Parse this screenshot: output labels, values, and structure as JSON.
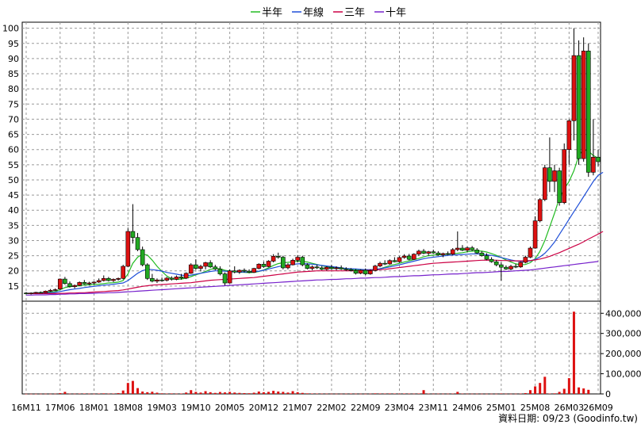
{
  "chart_data": {
    "type": "candlestick+volume",
    "title": "",
    "legend": [
      {
        "name": "半年",
        "color": "#22bb22"
      },
      {
        "name": "年線",
        "color": "#1f4fd8"
      },
      {
        "name": "三年",
        "color": "#cc0044"
      },
      {
        "name": "十年",
        "color": "#7722cc"
      }
    ],
    "legend_position": "top-center",
    "grid": true,
    "colors": {
      "up": "#dd1111",
      "down": "#22aa22",
      "volume": "#dd1111"
    },
    "price_axis": {
      "min": 10,
      "max": 102,
      "ticks": [
        15,
        20,
        25,
        30,
        35,
        40,
        45,
        50,
        55,
        60,
        65,
        70,
        75,
        80,
        85,
        90,
        95,
        100
      ]
    },
    "volume_axis": {
      "max": 460000,
      "ticks": [
        0,
        100000,
        200000,
        300000,
        400000
      ],
      "tick_labels": [
        "0",
        "100,000",
        "200,000",
        "300,000",
        "400,000"
      ]
    },
    "x_ticks": [
      {
        "label": "16M11",
        "i": 0
      },
      {
        "label": "17M06",
        "i": 7
      },
      {
        "label": "18M01",
        "i": 14
      },
      {
        "label": "18M08",
        "i": 21
      },
      {
        "label": "19M03",
        "i": 28
      },
      {
        "label": "19M10",
        "i": 35
      },
      {
        "label": "20M05",
        "i": 42
      },
      {
        "label": "20M12",
        "i": 49
      },
      {
        "label": "21M07",
        "i": 56
      },
      {
        "label": "22M02",
        "i": 63
      },
      {
        "label": "22M09",
        "i": 70
      },
      {
        "label": "23M04",
        "i": 77
      },
      {
        "label": "23M11",
        "i": 84
      },
      {
        "label": "24M06",
        "i": 91
      },
      {
        "label": "25M01",
        "i": 98
      },
      {
        "label": "25M08",
        "i": 105
      },
      {
        "label": "26M03",
        "i": 112
      },
      {
        "label": "26M09",
        "i": 118
      }
    ],
    "ohlc": [
      [
        12.7,
        13,
        12.3,
        12.5
      ],
      [
        12.5,
        12.9,
        12.2,
        12.7
      ],
      [
        12.7,
        13.1,
        12.5,
        12.9
      ],
      [
        12.9,
        13.2,
        12.6,
        12.8
      ],
      [
        12.8,
        13.5,
        12.7,
        13.3
      ],
      [
        13.3,
        14,
        13.1,
        13.6
      ],
      [
        13.6,
        14.2,
        13.4,
        13.8
      ],
      [
        14,
        17.5,
        13.8,
        17.3
      ],
      [
        17.3,
        18,
        15.5,
        15.8
      ],
      [
        15.8,
        16.5,
        14.5,
        14.8
      ],
      [
        14.8,
        15.5,
        14.2,
        15.2
      ],
      [
        15.2,
        16.5,
        15,
        16.2
      ],
      [
        16.2,
        17,
        15.5,
        15.7
      ],
      [
        15.7,
        16.4,
        15.3,
        16
      ],
      [
        16,
        16.5,
        15.5,
        16.3
      ],
      [
        16.3,
        17.5,
        16,
        16.8
      ],
      [
        16.8,
        18.5,
        16.5,
        17.5
      ],
      [
        17.5,
        18,
        16.5,
        16.8
      ],
      [
        16.8,
        17.5,
        16.3,
        17.2
      ],
      [
        17.2,
        17.8,
        16.8,
        17.5
      ],
      [
        17.5,
        22,
        17.2,
        21.5
      ],
      [
        21.5,
        34,
        21.2,
        33
      ],
      [
        33,
        42,
        29,
        31
      ],
      [
        31,
        32.5,
        26.5,
        27
      ],
      [
        27,
        28,
        21.5,
        22
      ],
      [
        22,
        22.5,
        17,
        17.5
      ],
      [
        17.5,
        19,
        16.2,
        16.6
      ],
      [
        16.6,
        17.5,
        16,
        17
      ],
      [
        17,
        17.8,
        16.4,
        16.9
      ],
      [
        16.9,
        18,
        16.5,
        17.6
      ],
      [
        17.6,
        18.2,
        16.8,
        17.2
      ],
      [
        17.2,
        18.5,
        16.9,
        18
      ],
      [
        18,
        19,
        17.1,
        17.6
      ],
      [
        17.6,
        19.5,
        17.3,
        19.2
      ],
      [
        19.2,
        22.5,
        19,
        22
      ],
      [
        22,
        23.8,
        20.4,
        20.8
      ],
      [
        20.8,
        22,
        19.8,
        21.5
      ],
      [
        21.5,
        23,
        20.5,
        22.7
      ],
      [
        22.7,
        23.5,
        21,
        21.3
      ],
      [
        21.3,
        22,
        20.2,
        20.6
      ],
      [
        20.6,
        21.5,
        18.5,
        19
      ],
      [
        19,
        19.5,
        15.2,
        16
      ],
      [
        16,
        20.5,
        15.8,
        20
      ],
      [
        20,
        21.5,
        19.2,
        19.6
      ],
      [
        19.6,
        20.5,
        19,
        20.2
      ],
      [
        20.2,
        20.8,
        19.5,
        19.9
      ],
      [
        19.9,
        20.5,
        19.2,
        19.5
      ],
      [
        19.5,
        21,
        19.3,
        20.8
      ],
      [
        20.8,
        22.5,
        20.5,
        22.2
      ],
      [
        22.2,
        23,
        21,
        21.4
      ],
      [
        21.4,
        23.5,
        21.2,
        23.2
      ],
      [
        23.2,
        25.5,
        22.8,
        24.8
      ],
      [
        24.8,
        26,
        24,
        24.5
      ],
      [
        24.5,
        25,
        20.5,
        21
      ],
      [
        21,
        22.5,
        20.5,
        22
      ],
      [
        22,
        24,
        21.8,
        23.5
      ],
      [
        23.5,
        25.2,
        22.8,
        24.5
      ],
      [
        24.5,
        25,
        21.5,
        22
      ],
      [
        22,
        22.5,
        20.5,
        20.8
      ],
      [
        20.8,
        21.8,
        20.2,
        21.3
      ],
      [
        21.3,
        22,
        20.6,
        21
      ],
      [
        21,
        21.6,
        20.2,
        20.5
      ],
      [
        20.5,
        21.5,
        20.1,
        21.2
      ],
      [
        21.2,
        22,
        20.4,
        20.7
      ],
      [
        20.7,
        21.5,
        20.2,
        21
      ],
      [
        21,
        21.8,
        20.3,
        20.6
      ],
      [
        20.6,
        21.2,
        20,
        20.4
      ],
      [
        20.4,
        20.9,
        19.8,
        20.1
      ],
      [
        20.1,
        20.6,
        18.8,
        19.2
      ],
      [
        19.2,
        20.5,
        18.9,
        20.2
      ],
      [
        20.2,
        20.8,
        18.6,
        19
      ],
      [
        19,
        20.5,
        18.7,
        20.1
      ],
      [
        20.1,
        22,
        19.8,
        21.6
      ],
      [
        21.6,
        23,
        21.2,
        22.5
      ],
      [
        22.5,
        23.5,
        21.9,
        22.3
      ],
      [
        22.3,
        23.8,
        22,
        23.4
      ],
      [
        23.4,
        24.5,
        22.8,
        23
      ],
      [
        23,
        24.8,
        22.7,
        24.4
      ],
      [
        24.4,
        25.5,
        24,
        24.9
      ],
      [
        24.9,
        25.6,
        23.5,
        23.8
      ],
      [
        23.8,
        25.8,
        23.6,
        25.5
      ],
      [
        25.5,
        27,
        25,
        26.5
      ],
      [
        26.5,
        27.2,
        25.5,
        25.8
      ],
      [
        25.8,
        26.6,
        25,
        26.3
      ],
      [
        26.3,
        27,
        25.6,
        25.9
      ],
      [
        25.9,
        26.5,
        25,
        25.3
      ],
      [
        25.3,
        26,
        24.5,
        25.7
      ],
      [
        25.7,
        26.4,
        25.2,
        25.5
      ],
      [
        25.5,
        27.5,
        25.2,
        27
      ],
      [
        27,
        33,
        26.5,
        27.5
      ],
      [
        27.5,
        28.5,
        26.5,
        26.8
      ],
      [
        26.8,
        28,
        26.2,
        27.6
      ],
      [
        27.6,
        28.2,
        26.6,
        26.9
      ],
      [
        26.9,
        27.5,
        25.6,
        25.9
      ],
      [
        25.9,
        26.5,
        24.7,
        25
      ],
      [
        25,
        25.8,
        23.5,
        23.8
      ],
      [
        23.8,
        24.5,
        22.7,
        23
      ],
      [
        23,
        23.6,
        21.5,
        22
      ],
      [
        22,
        22.8,
        16.8,
        21.2
      ],
      [
        21.2,
        21.8,
        20.3,
        20.6
      ],
      [
        20.6,
        22,
        20.2,
        21.5
      ],
      [
        21.5,
        22.3,
        20.9,
        21.3
      ],
      [
        21.3,
        23,
        21,
        22.8
      ],
      [
        22.8,
        25,
        22.5,
        24.5
      ],
      [
        24.5,
        28,
        24.2,
        27.5
      ],
      [
        27.5,
        38,
        27.3,
        36.5
      ],
      [
        36.5,
        44,
        36,
        43.5
      ],
      [
        43.5,
        55,
        43,
        54
      ],
      [
        54,
        64,
        46,
        49.5
      ],
      [
        49.5,
        55,
        46,
        53
      ],
      [
        53,
        54,
        41.5,
        42.5
      ],
      [
        42.5,
        62,
        42,
        60
      ],
      [
        60,
        70,
        55,
        69.5
      ],
      [
        69.5,
        100,
        63,
        91
      ],
      [
        91,
        96,
        55,
        57
      ],
      [
        57,
        97,
        56,
        92.5
      ],
      [
        92.5,
        95,
        51,
        52.5
      ],
      [
        52.5,
        70,
        51.5,
        57.5
      ],
      [
        57.5,
        60,
        54.5,
        56
      ]
    ],
    "volume": [
      1500,
      2000,
      1800,
      2500,
      3000,
      2200,
      3500,
      12000,
      30000,
      4000,
      3500,
      5000,
      6000,
      4000,
      3000,
      5500,
      8000,
      4500,
      6000,
      12000,
      50000,
      160000,
      190000,
      85000,
      35000,
      25000,
      32000,
      18000,
      8000,
      5000,
      7000,
      4000,
      6000,
      20000,
      55000,
      30000,
      20000,
      40000,
      25000,
      15000,
      28000,
      22000,
      30000,
      20000,
      15000,
      12000,
      10000,
      18000,
      35000,
      25000,
      30000,
      45000,
      35000,
      30000,
      20000,
      40000,
      25000,
      15000,
      8000,
      6000,
      5000,
      4500,
      4000,
      3500,
      3000,
      2800,
      4000,
      5000,
      3500,
      3000,
      2500,
      4000,
      8000,
      6500,
      5000,
      7000,
      5500,
      4500,
      6000,
      5000,
      4000,
      6000,
      55000,
      5000,
      3500,
      4000,
      3000,
      3500,
      5000,
      30000,
      4500,
      3500,
      3000,
      3500,
      3000,
      2500,
      3000,
      2500,
      6000,
      3000,
      2500,
      3000,
      5000,
      12000,
      55000,
      110000,
      160000,
      250000,
      6000,
      8000,
      30000,
      75000,
      230000,
      1200000,
      95000,
      80000,
      60000
    ],
    "vol_scale": 0.34,
    "ma": {
      "半年": [
        12.6,
        12.6,
        12.7,
        12.8,
        12.9,
        13,
        13.2,
        13.8,
        14.5,
        14.8,
        14.9,
        15.1,
        15.3,
        15.4,
        15.5,
        15.6,
        15.8,
        16,
        16.1,
        16.3,
        16.8,
        19,
        22.5,
        24.5,
        25.5,
        25.2,
        23.5,
        21.5,
        19.8,
        18.3,
        17.4,
        17.2,
        17.3,
        17.6,
        18.1,
        18.7,
        19.2,
        19.8,
        20.5,
        20.8,
        20.7,
        20.2,
        19.9,
        19.7,
        19.6,
        19.5,
        19.4,
        19.5,
        19.8,
        20.3,
        21,
        21.8,
        22.4,
        22.7,
        22.8,
        23,
        23.2,
        23.1,
        22.9,
        22.5,
        22.1,
        21.7,
        21.4,
        21.1,
        20.9,
        20.8,
        20.6,
        20.5,
        20.3,
        20.2,
        20.1,
        20.1,
        20.3,
        20.7,
        21.2,
        21.7,
        22.1,
        22.5,
        22.9,
        23.3,
        23.7,
        24.1,
        24.6,
        25,
        25.2,
        25.3,
        25.4,
        25.5,
        25.6,
        25.8,
        26,
        26.3,
        26.5,
        26.6,
        26.5,
        26.2,
        25.7,
        25.1,
        24.4,
        23.6,
        22.9,
        22.3,
        22,
        22.1,
        22.7,
        24,
        26.5,
        30,
        34.5,
        39,
        44,
        47,
        49.5,
        53,
        58,
        60,
        59.5,
        58,
        57.2
      ],
      "年線": [
        12.6,
        12.6,
        12.6,
        12.7,
        12.7,
        12.8,
        12.9,
        13.2,
        13.5,
        13.8,
        14,
        14.2,
        14.5,
        14.7,
        14.9,
        15.1,
        15.3,
        15.4,
        15.6,
        15.8,
        16,
        16.8,
        18,
        19.2,
        20.1,
        20.5,
        20.4,
        20.2,
        19.9,
        19.5,
        19.2,
        18.9,
        18.6,
        18.4,
        18.6,
        18.9,
        19.2,
        19.5,
        19.8,
        20,
        20,
        19.9,
        19.8,
        19.7,
        19.6,
        19.6,
        19.6,
        19.7,
        19.9,
        20.2,
        20.6,
        21,
        21.4,
        21.7,
        21.9,
        22.1,
        22.3,
        22.4,
        22.3,
        22.2,
        22,
        21.8,
        21.6,
        21.4,
        21.2,
        21,
        20.8,
        20.7,
        20.6,
        20.5,
        20.4,
        20.4,
        20.5,
        20.7,
        21,
        21.3,
        21.6,
        22,
        22.4,
        22.8,
        23.2,
        23.6,
        24,
        24.3,
        24.5,
        24.7,
        24.9,
        25.1,
        25.2,
        25.3,
        25.4,
        25.5,
        25.6,
        25.6,
        25.5,
        25.3,
        25.1,
        24.8,
        24.4,
        24,
        23.6,
        23.3,
        23.1,
        23.1,
        23.3,
        23.8,
        24.6,
        25.8,
        27.5,
        29.5,
        32,
        34.5,
        37,
        39.5,
        42,
        44.5,
        47,
        49.5,
        51.5,
        52.5
      ],
      "三年": [
        12.5,
        12.5,
        12.5,
        12.5,
        12.5,
        12.5,
        12.5,
        12.6,
        12.6,
        12.7,
        12.7,
        12.8,
        12.8,
        12.9,
        13,
        13.1,
        13.2,
        13.3,
        13.4,
        13.5,
        13.7,
        14,
        14.3,
        14.6,
        14.9,
        15.1,
        15.3,
        15.4,
        15.5,
        15.6,
        15.7,
        15.8,
        15.9,
        16,
        16.1,
        16.3,
        16.5,
        16.7,
        16.9,
        17,
        17.1,
        17.2,
        17.3,
        17.4,
        17.5,
        17.6,
        17.7,
        17.8,
        18,
        18.2,
        18.4,
        18.6,
        18.8,
        19,
        19.2,
        19.4,
        19.6,
        19.7,
        19.8,
        19.9,
        20,
        20,
        20,
        20,
        20,
        20,
        20,
        20,
        20,
        20.1,
        20.1,
        20.2,
        20.3,
        20.4,
        20.5,
        20.7,
        20.9,
        21.1,
        21.3,
        21.5,
        21.7,
        21.9,
        22.1,
        22.3,
        22.5,
        22.6,
        22.7,
        22.8,
        22.9,
        23,
        23.1,
        23.2,
        23.3,
        23.4,
        23.5,
        23.5,
        23.5,
        23.5,
        23.4,
        23.4,
        23.3,
        23.3,
        23.3,
        23.3,
        23.4,
        23.6,
        23.9,
        24.3,
        24.8,
        25.4,
        26,
        26.7,
        27.4,
        28.1,
        28.8,
        29.6,
        30.5,
        31.3,
        32.1,
        33
      ],
      "十年": [
        12,
        12,
        12.1,
        12.1,
        12.1,
        12.2,
        12.2,
        12.3,
        12.3,
        12.4,
        12.4,
        12.5,
        12.5,
        12.6,
        12.6,
        12.7,
        12.7,
        12.8,
        12.8,
        12.9,
        13,
        13.1,
        13.2,
        13.3,
        13.4,
        13.5,
        13.6,
        13.7,
        13.8,
        13.9,
        14,
        14.1,
        14.2,
        14.3,
        14.4,
        14.5,
        14.6,
        14.7,
        14.8,
        14.9,
        15,
        15.1,
        15.2,
        15.3,
        15.4,
        15.5,
        15.6,
        15.7,
        15.8,
        15.9,
        16,
        16.1,
        16.2,
        16.3,
        16.4,
        16.5,
        16.6,
        16.7,
        16.8,
        16.9,
        17,
        17,
        17.1,
        17.2,
        17.2,
        17.3,
        17.4,
        17.4,
        17.5,
        17.6,
        17.6,
        17.7,
        17.8,
        17.8,
        17.9,
        18,
        18.1,
        18.1,
        18.2,
        18.3,
        18.4,
        18.4,
        18.5,
        18.6,
        18.7,
        18.7,
        18.8,
        18.9,
        19,
        19,
        19.1,
        19.2,
        19.3,
        19.4,
        19.4,
        19.5,
        19.6,
        19.7,
        19.8,
        19.8,
        19.9,
        20,
        20.1,
        20.2,
        20.3,
        20.5,
        20.7,
        20.9,
        21.1,
        21.3,
        21.5,
        21.7,
        21.9,
        22.1,
        22.3,
        22.5,
        22.7,
        22.9,
        23.1
      ]
    },
    "credit": "資料日期: 09/23  (Goodinfo.tw)"
  }
}
